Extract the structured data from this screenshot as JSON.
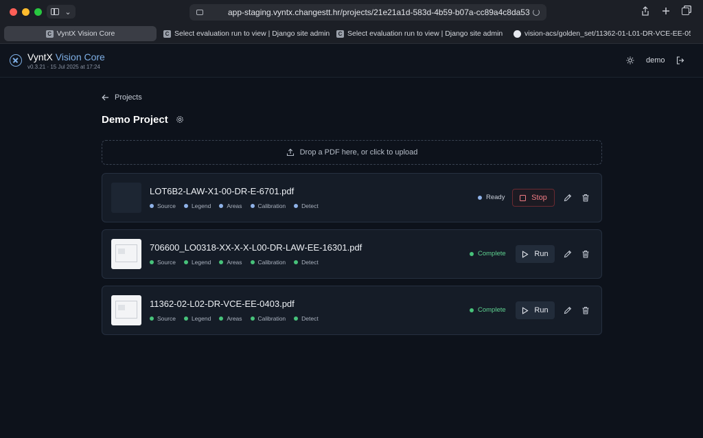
{
  "browser": {
    "url": "app-staging.vyntx.changestt.hr/projects/21e21a1d-583d-4b59-b07a-cc89a4c8da53",
    "tabs": [
      {
        "label": "VyntX Vision Core",
        "favicon": "C"
      },
      {
        "label": "Select evaluation run to view | Django site admin",
        "favicon": "C"
      },
      {
        "label": "Select evaluation run to view | Django site admin",
        "favicon": "C"
      },
      {
        "label": "vision-acs/golden_set/11362-01-L01-DR-VCE-EE-050...",
        "favicon": "github-icon"
      }
    ]
  },
  "header": {
    "brand_primary": "VyntX",
    "brand_accent": "Vision Core",
    "version": "v0.3.21 · 15 Jul 2025 at 17:24",
    "user": "demo"
  },
  "main": {
    "back_label": "Projects",
    "title": "Demo Project",
    "dropzone_label": "Drop a PDF here, or click to upload"
  },
  "step_labels": [
    "Source",
    "Legend",
    "Areas",
    "Calibration",
    "Detect"
  ],
  "files": [
    {
      "name": "LOT6B2-LAW-X1-00-DR-E-6701.pdf",
      "status": "Ready",
      "action": "Stop"
    },
    {
      "name": "706600_LO0318-XX-X-X-L00-DR-LAW-EE-16301.pdf",
      "status": "Complete",
      "action": "Run"
    },
    {
      "name": "11362-02-L02-DR-VCE-EE-0403.pdf",
      "status": "Complete",
      "action": "Run"
    }
  ],
  "colors": {
    "background": "#0d121b",
    "card": "#151c27",
    "accent": "#7fb0e6",
    "complete": "#47c27a",
    "ready": "#8fb2e8",
    "stop": "#f17c84"
  }
}
